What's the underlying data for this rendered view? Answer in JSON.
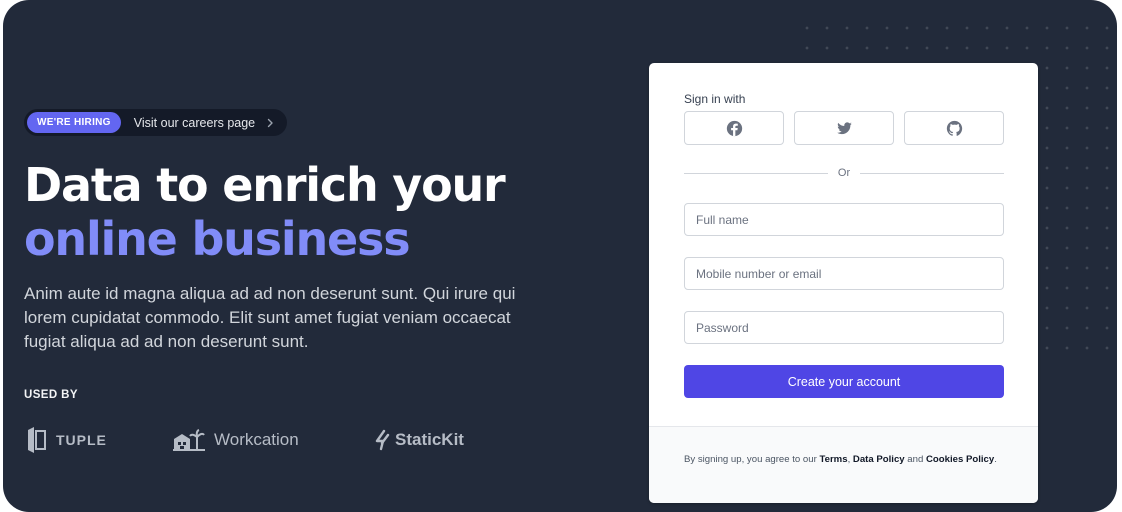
{
  "hiring": {
    "badge": "WE'RE HIRING",
    "link": "Visit our careers page",
    "chevron_icon": "chevron-right-icon"
  },
  "hero": {
    "headline_line1": "Data to enrich your",
    "headline_line2": "online business",
    "description": "Anim aute id magna aliqua ad ad non deserunt sunt. Qui irure qui lorem cupidatat commodo. Elit sunt amet fugiat veniam occaecat fugiat aliqua ad ad non deserunt sunt."
  },
  "used_by": {
    "label": "USED BY",
    "logos": [
      {
        "name": "TUPLE",
        "icon": "tuple-logo-icon"
      },
      {
        "name": "Workcation",
        "icon": "workcation-logo-icon"
      },
      {
        "name": "StaticKit",
        "icon": "statickit-logo-icon"
      }
    ]
  },
  "signup": {
    "signin_label": "Sign in with",
    "social": [
      {
        "name": "Facebook",
        "icon": "facebook-icon"
      },
      {
        "name": "Twitter",
        "icon": "twitter-icon"
      },
      {
        "name": "GitHub",
        "icon": "github-icon"
      }
    ],
    "divider": "Or",
    "fields": {
      "full_name_placeholder": "Full name",
      "full_name_value": "",
      "contact_placeholder": "Mobile number or email",
      "contact_value": "",
      "password_placeholder": "Password",
      "password_value": ""
    },
    "submit_label": "Create your account",
    "legal": {
      "prefix": "By signing up, you agree to our ",
      "terms": "Terms",
      "comma": ", ",
      "data_policy": "Data Policy",
      "and": " and ",
      "cookies_policy": "Cookies Policy",
      "suffix": "."
    }
  },
  "colors": {
    "background": "#222a3a",
    "accent": "#6366f1",
    "accent_light": "#818cf8",
    "button": "#4f46e5"
  }
}
